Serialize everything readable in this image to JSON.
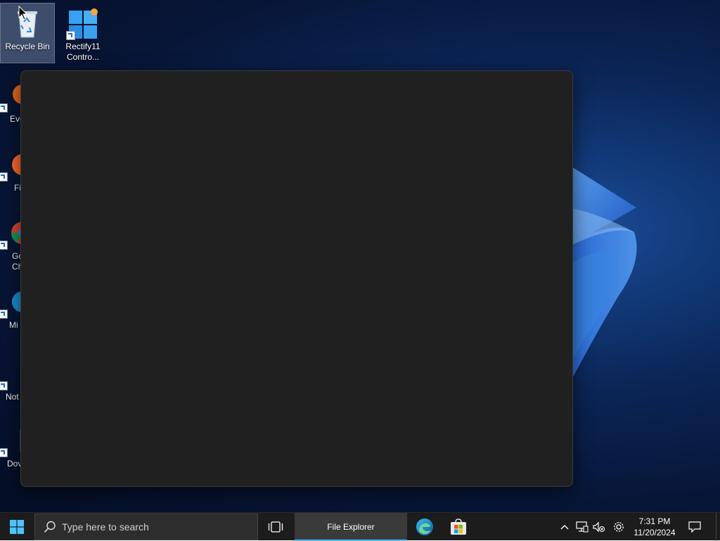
{
  "desktop": {
    "icons": [
      {
        "label": "Recycle Bin"
      },
      {
        "label": "Rectify11 Contro..."
      },
      {
        "label": "Eve"
      },
      {
        "label": "Fi"
      },
      {
        "label": "Go Ch"
      },
      {
        "label": "Mi E"
      },
      {
        "label": "Not"
      },
      {
        "label": "Dov"
      }
    ]
  },
  "taskbar": {
    "search_placeholder": "Type here to search",
    "file_explorer_label": "File Explorer",
    "time": "7:31 PM",
    "date": "11/20/2024"
  },
  "colors": {
    "taskbar_bg": "#1c1c1c",
    "window_bg": "#202020",
    "accent": "#4cc2ff"
  }
}
